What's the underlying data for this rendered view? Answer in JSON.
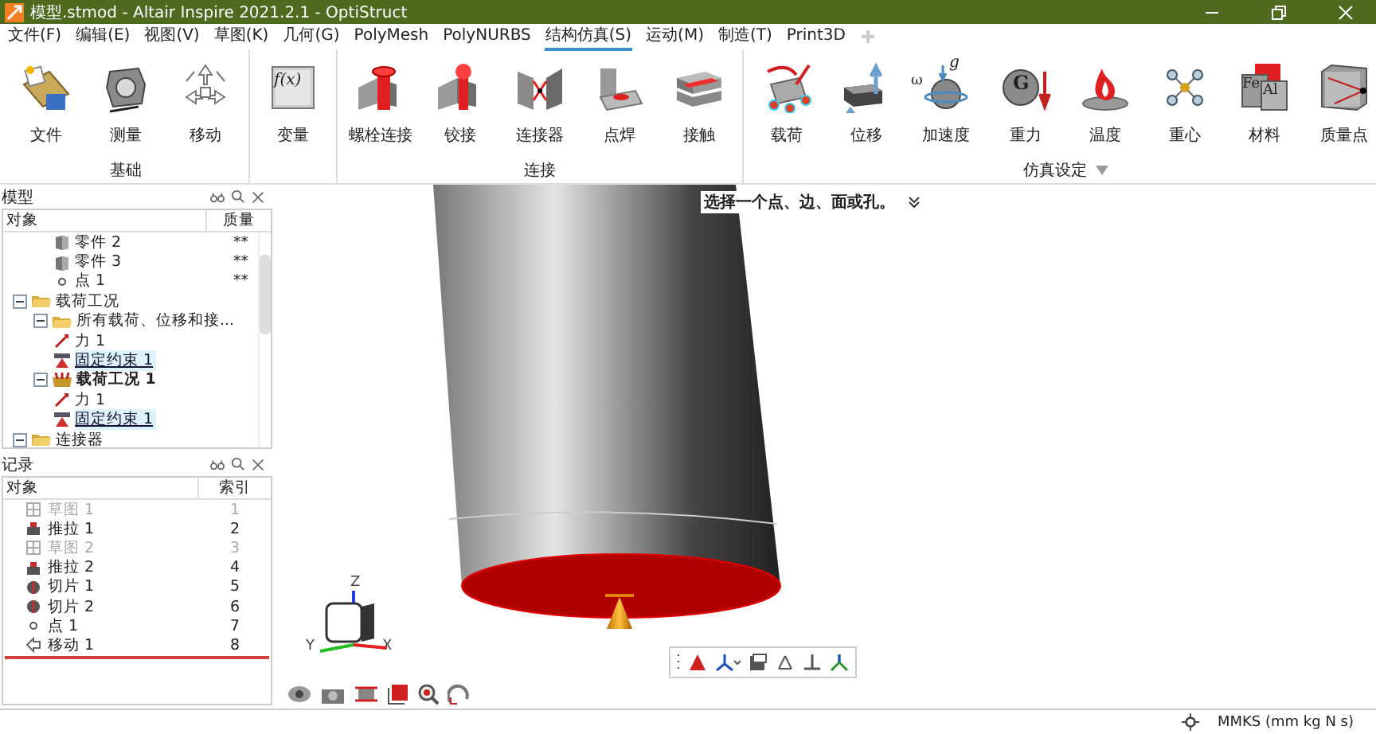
{
  "window": {
    "title": "模型.stmod - Altair Inspire 2021.2.1 - OptiStruct"
  },
  "menu": [
    {
      "label": "文件(F)",
      "selected": false
    },
    {
      "label": "编辑(E)",
      "selected": false
    },
    {
      "label": "视图(V)",
      "selected": false
    },
    {
      "label": "草图(K)",
      "selected": false
    },
    {
      "label": "几何(G)",
      "selected": false
    },
    {
      "label": "PolyMesh",
      "selected": false
    },
    {
      "label": "PolyNURBS",
      "selected": false
    },
    {
      "label": "结构仿真(S)",
      "selected": true
    },
    {
      "label": "运动(M)",
      "selected": false
    },
    {
      "label": "制造(T)",
      "selected": false
    },
    {
      "label": "Print3D",
      "selected": false
    }
  ],
  "ribbon": [
    {
      "label": "基础",
      "tools": [
        {
          "label": "文件"
        },
        {
          "label": "测量"
        },
        {
          "label": "移动"
        }
      ]
    },
    {
      "tools": [
        {
          "label": "变量",
          "icon_texts": [
            "f(x)"
          ]
        }
      ]
    },
    {
      "label": "连接",
      "tools": [
        {
          "label": "螺栓连接"
        },
        {
          "label": "铰接"
        },
        {
          "label": "连接器"
        },
        {
          "label": "点焊"
        },
        {
          "label": "接触"
        }
      ]
    },
    {
      "label": "仿真设定",
      "dropdown": true,
      "tools": [
        {
          "label": "载荷"
        },
        {
          "label": "位移"
        },
        {
          "label": "加速度",
          "icon_texts": [
            "g",
            "ω"
          ]
        },
        {
          "label": "重力",
          "icon_texts": [
            "G"
          ]
        },
        {
          "label": "温度"
        },
        {
          "label": "重心"
        },
        {
          "label": "材料",
          "icon_texts": [
            "Fe",
            "Al"
          ]
        },
        {
          "label": "质量点"
        }
      ]
    }
  ],
  "model_panel": {
    "title": "模型",
    "columns": [
      "对象",
      "质量"
    ],
    "continued_items": [
      {
        "label": "零件 2",
        "mass": "**",
        "kind": "part"
      },
      {
        "label": "零件 3",
        "mass": "**",
        "kind": "part"
      },
      {
        "label": "点 1",
        "mass": "**",
        "kind": "point"
      }
    ],
    "tree": [
      {
        "label": "载荷工况",
        "kind": "folder",
        "expanded": true,
        "children": [
          {
            "label": "所有载荷、位移和接...",
            "kind": "folder",
            "expanded": true,
            "children": [
              {
                "label": "力 1",
                "kind": "force",
                "selected": false
              },
              {
                "label": "固定约束 1",
                "kind": "support",
                "selected": true
              }
            ]
          },
          {
            "label": "载荷工况 1",
            "kind": "loadcase",
            "expanded": true,
            "children": [
              {
                "label": "力 1",
                "kind": "force",
                "selected": false
              },
              {
                "label": "固定约束 1",
                "kind": "support",
                "selected": true
              }
            ]
          }
        ]
      },
      {
        "label": "连接器",
        "kind": "folder",
        "expanded": true
      }
    ]
  },
  "history_panel": {
    "title": "记录",
    "columns": [
      "对象",
      "索引"
    ],
    "rows": [
      {
        "label": "草图 1",
        "index": "1",
        "kind": "sketch",
        "disabled": true
      },
      {
        "label": "推拉 1",
        "index": "2",
        "kind": "pushpull",
        "disabled": false
      },
      {
        "label": "草图 2",
        "index": "3",
        "kind": "sketch",
        "disabled": true
      },
      {
        "label": "推拉 2",
        "index": "4",
        "kind": "pushpull",
        "disabled": false
      },
      {
        "label": "切片 1",
        "index": "5",
        "kind": "slice",
        "disabled": false
      },
      {
        "label": "切片 2",
        "index": "6",
        "kind": "slice",
        "disabled": false
      },
      {
        "label": "点 1",
        "index": "7",
        "kind": "point",
        "disabled": false
      },
      {
        "label": "移动 1",
        "index": "8",
        "kind": "move",
        "disabled": false
      }
    ]
  },
  "viewport": {
    "prompt": "选择一个点、边、面或孔。",
    "axes": [
      "Z",
      "Y",
      "X"
    ]
  },
  "status_bar": {
    "units": "MMKS (mm kg N s)"
  }
}
